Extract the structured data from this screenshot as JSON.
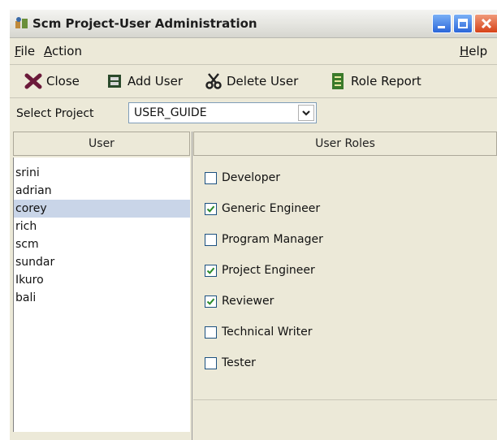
{
  "window": {
    "title": "Scm Project-User Administration",
    "icons": {
      "app": "app-icon",
      "minimize": "minimize-icon",
      "maximize": "maximize-icon",
      "close": "close-icon"
    }
  },
  "menu": {
    "file": {
      "mnemonic": "F",
      "rest": "ile"
    },
    "action": {
      "mnemonic": "A",
      "rest": "ction"
    },
    "help": {
      "mnemonic": "H",
      "rest": "elp"
    }
  },
  "toolbar": {
    "close_label": "Close",
    "add_user_label": "Add User",
    "delete_user_label": "Delete User",
    "role_report_label": "Role Report"
  },
  "project": {
    "label": "Select Project",
    "selected": "USER_GUIDE"
  },
  "users": {
    "header": "User",
    "items": [
      "srini",
      "adrian",
      "corey",
      "rich",
      "scm",
      "sundar",
      "Ikuro",
      "bali"
    ],
    "selected": "corey"
  },
  "roles": {
    "header": "User Roles",
    "items": [
      {
        "label": "Developer",
        "checked": false
      },
      {
        "label": "Generic Engineer",
        "checked": true
      },
      {
        "label": "Program Manager",
        "checked": false
      },
      {
        "label": "Project Engineer",
        "checked": true
      },
      {
        "label": "Reviewer",
        "checked": true
      },
      {
        "label": "Technical Writer",
        "checked": false
      },
      {
        "label": "Tester",
        "checked": false
      }
    ]
  },
  "colors": {
    "selection": "#c9d5e8",
    "window_bg": "#ece9d8",
    "checkmark": "#2a8a2a"
  }
}
